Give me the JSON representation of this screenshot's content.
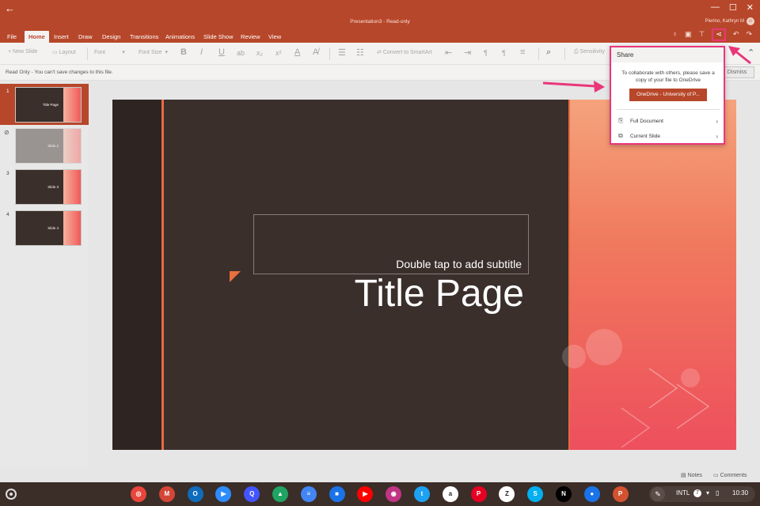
{
  "window": {
    "title": "Presentation3 - Read-only",
    "user": "Pierino, Kathryn M",
    "minimize": "—",
    "maximize": "☐",
    "close": "✕"
  },
  "ribbon": {
    "tabs": [
      "File",
      "Home",
      "Insert",
      "Draw",
      "Design",
      "Transitions",
      "Animations",
      "Slide Show",
      "Review",
      "View"
    ],
    "active_tab": "Home"
  },
  "toolbar": {
    "new_slide": "New Slide",
    "layout": "Layout",
    "font": "Font",
    "font_size": "Font Size",
    "bold": "B",
    "italic": "I",
    "underline": "U",
    "strike": "ab",
    "subscript": "x₂",
    "superscript": "x²",
    "convert_smartart": "Convert to SmartArt",
    "sensitivity": "Sensitivity"
  },
  "infobar": {
    "message": "Read Only - You can't save changes to this file.",
    "dismiss": "Dismiss"
  },
  "thumbnails": [
    {
      "num": "1",
      "label": "Title Page",
      "selected": true,
      "hidden": false
    },
    {
      "num": "",
      "label": "Slide 2",
      "selected": false,
      "hidden": true
    },
    {
      "num": "3",
      "label": "Slide 3",
      "selected": false,
      "hidden": false
    },
    {
      "num": "4",
      "label": "Slide 4",
      "selected": false,
      "hidden": false
    }
  ],
  "slide": {
    "subtitle_placeholder": "Double tap to add subtitle",
    "title": "Title Page"
  },
  "share_panel": {
    "heading": "Share",
    "message": "To collaborate with others, please save a copy of your file to OneDrive",
    "onedrive_button": "OneDrive - University of P...",
    "items": [
      {
        "label": "Full Document",
        "icon": "paperclip-icon"
      },
      {
        "label": "Current Slide",
        "icon": "slides-icon"
      }
    ]
  },
  "statusbar": {
    "notes": "Notes",
    "comments": "Comments"
  },
  "shelf": {
    "apps": [
      {
        "name": "chrome-icon",
        "color": "#e8453c",
        "glyph": "◎"
      },
      {
        "name": "gmail-icon",
        "color": "#d44638",
        "glyph": "M"
      },
      {
        "name": "outlook-icon",
        "color": "#0f6cbd",
        "glyph": "O"
      },
      {
        "name": "zoom-icon",
        "color": "#2d8cff",
        "glyph": "▶"
      },
      {
        "name": "quizlet-icon",
        "color": "#4255ff",
        "glyph": "Q"
      },
      {
        "name": "drive-icon",
        "color": "#1fa463",
        "glyph": "▲"
      },
      {
        "name": "docs-icon",
        "color": "#4285f4",
        "glyph": "≡"
      },
      {
        "name": "files-icon",
        "color": "#1a73e8",
        "glyph": "■"
      },
      {
        "name": "youtube-icon",
        "color": "#ff0000",
        "glyph": "▶"
      },
      {
        "name": "instagram-icon",
        "color": "#c13584",
        "glyph": "◉"
      },
      {
        "name": "twitter-icon",
        "color": "#1da1f2",
        "glyph": "t"
      },
      {
        "name": "amazon-icon",
        "color": "#ffffff",
        "glyph": "a"
      },
      {
        "name": "pinterest-icon",
        "color": "#e60023",
        "glyph": "P"
      },
      {
        "name": "zara-icon",
        "color": "#ffffff",
        "glyph": "Z"
      },
      {
        "name": "skype-icon",
        "color": "#00aff0",
        "glyph": "S"
      },
      {
        "name": "netflix-icon",
        "color": "#000000",
        "glyph": "N"
      },
      {
        "name": "duo-icon",
        "color": "#1a73e8",
        "glyph": "●"
      },
      {
        "name": "powerpoint-icon",
        "color": "#d35230",
        "glyph": "P"
      }
    ],
    "locale": "INTL",
    "notification_count": "7",
    "time": "10:30"
  }
}
